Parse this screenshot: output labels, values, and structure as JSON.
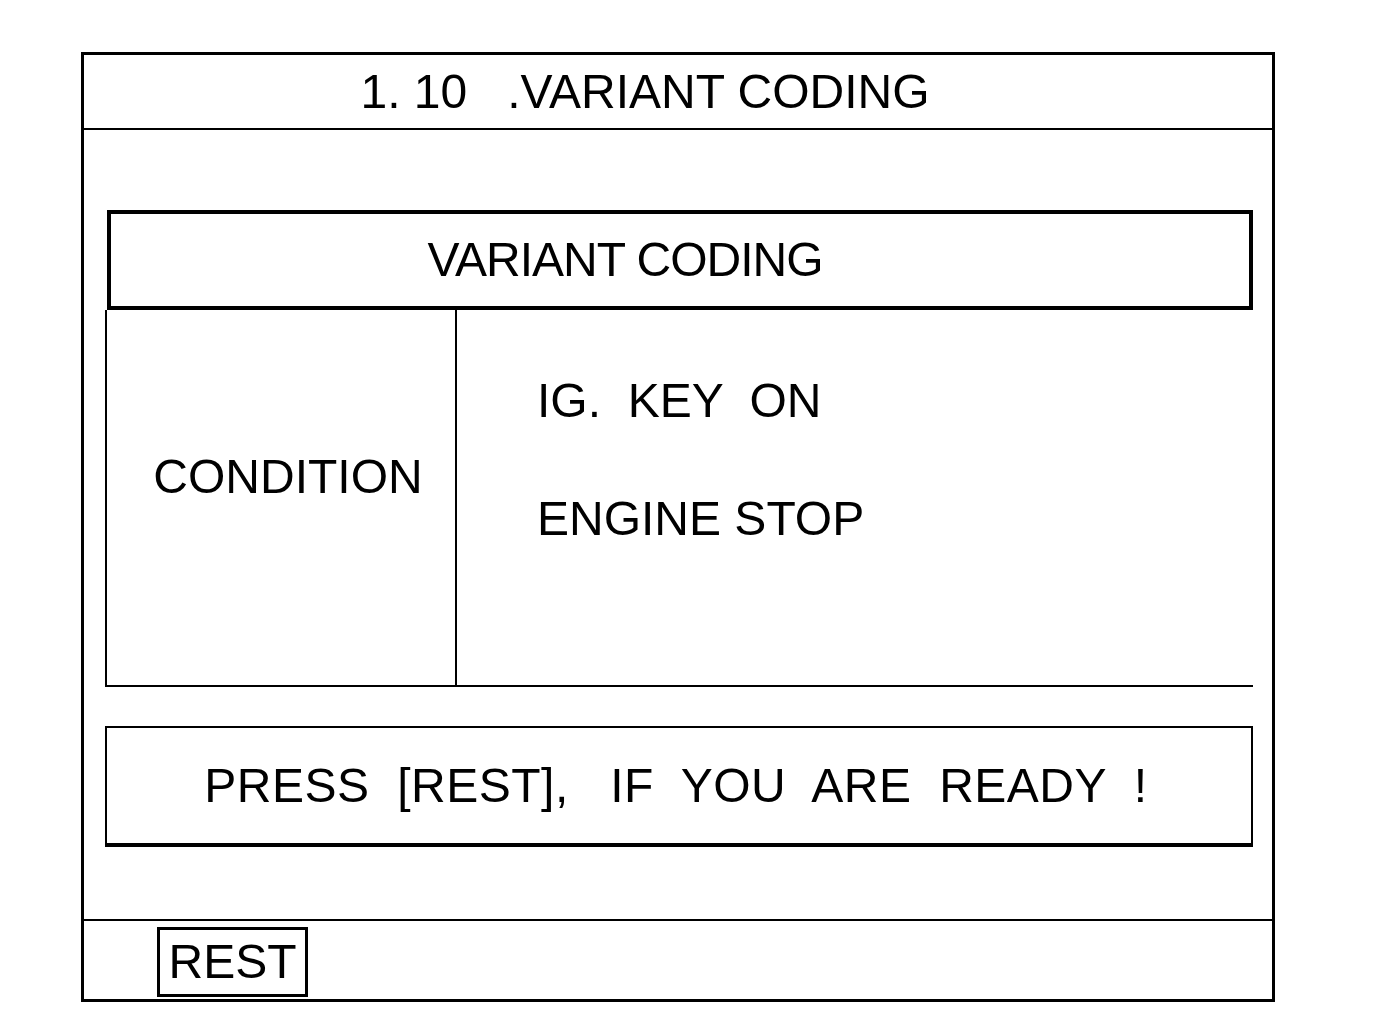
{
  "screen": {
    "title": "1. 10   .VARIANT CODING"
  },
  "panel": {
    "heading": "VARIANT CODING",
    "condition": {
      "label": "CONDITION",
      "items": [
        "IG.  KEY  ON",
        "ENGINE STOP"
      ]
    }
  },
  "message": "PRESS  [REST],   IF  YOU  ARE  READY  !",
  "footer": {
    "buttons": [
      {
        "label": "REST"
      }
    ]
  }
}
